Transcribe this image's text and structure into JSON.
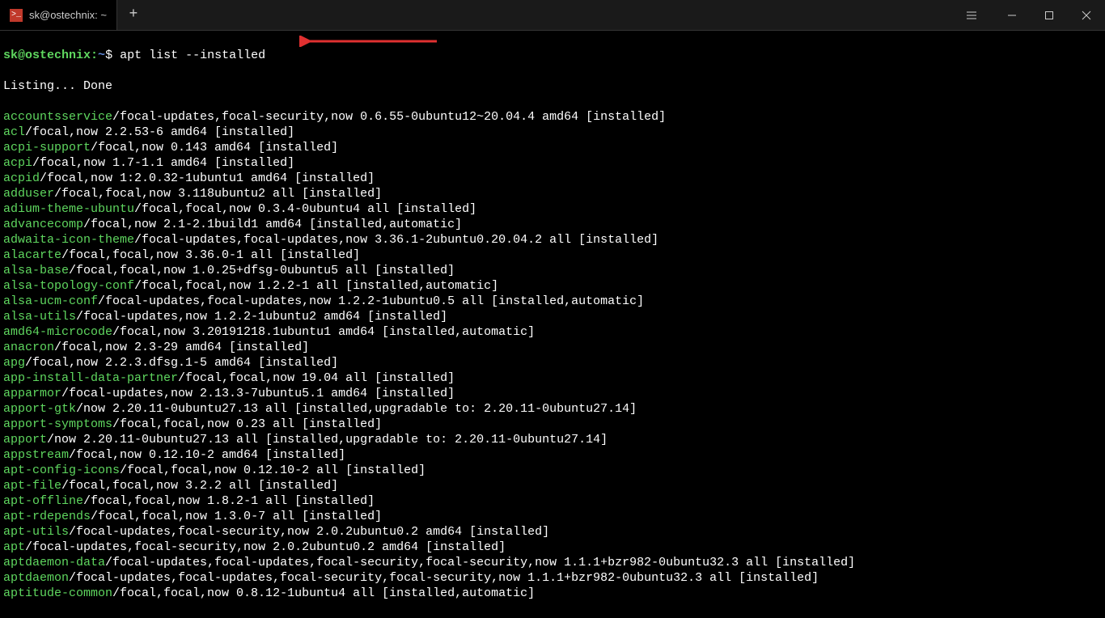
{
  "titlebar": {
    "tab_title": "sk@ostechnix: ~",
    "new_tab": "+"
  },
  "prompt": {
    "user_host": "sk@ostechnix",
    "sep": ":",
    "path": "~",
    "dollar": "$",
    "command": "apt list --installed"
  },
  "listing_line": "Listing... Done",
  "packages": [
    {
      "pkg": "accountsservice",
      "rest": "/focal-updates,focal-security,now 0.6.55-0ubuntu12~20.04.4 amd64 [installed]"
    },
    {
      "pkg": "acl",
      "rest": "/focal,now 2.2.53-6 amd64 [installed]"
    },
    {
      "pkg": "acpi-support",
      "rest": "/focal,now 0.143 amd64 [installed]"
    },
    {
      "pkg": "acpi",
      "rest": "/focal,now 1.7-1.1 amd64 [installed]"
    },
    {
      "pkg": "acpid",
      "rest": "/focal,now 1:2.0.32-1ubuntu1 amd64 [installed]"
    },
    {
      "pkg": "adduser",
      "rest": "/focal,focal,now 3.118ubuntu2 all [installed]"
    },
    {
      "pkg": "adium-theme-ubuntu",
      "rest": "/focal,focal,now 0.3.4-0ubuntu4 all [installed]"
    },
    {
      "pkg": "advancecomp",
      "rest": "/focal,now 2.1-2.1build1 amd64 [installed,automatic]"
    },
    {
      "pkg": "adwaita-icon-theme",
      "rest": "/focal-updates,focal-updates,now 3.36.1-2ubuntu0.20.04.2 all [installed]"
    },
    {
      "pkg": "alacarte",
      "rest": "/focal,focal,now 3.36.0-1 all [installed]"
    },
    {
      "pkg": "alsa-base",
      "rest": "/focal,focal,now 1.0.25+dfsg-0ubuntu5 all [installed]"
    },
    {
      "pkg": "alsa-topology-conf",
      "rest": "/focal,focal,now 1.2.2-1 all [installed,automatic]"
    },
    {
      "pkg": "alsa-ucm-conf",
      "rest": "/focal-updates,focal-updates,now 1.2.2-1ubuntu0.5 all [installed,automatic]"
    },
    {
      "pkg": "alsa-utils",
      "rest": "/focal-updates,now 1.2.2-1ubuntu2 amd64 [installed]"
    },
    {
      "pkg": "amd64-microcode",
      "rest": "/focal,now 3.20191218.1ubuntu1 amd64 [installed,automatic]"
    },
    {
      "pkg": "anacron",
      "rest": "/focal,now 2.3-29 amd64 [installed]"
    },
    {
      "pkg": "apg",
      "rest": "/focal,now 2.2.3.dfsg.1-5 amd64 [installed]"
    },
    {
      "pkg": "app-install-data-partner",
      "rest": "/focal,focal,now 19.04 all [installed]"
    },
    {
      "pkg": "apparmor",
      "rest": "/focal-updates,now 2.13.3-7ubuntu5.1 amd64 [installed]"
    },
    {
      "pkg": "apport-gtk",
      "rest": "/now 2.20.11-0ubuntu27.13 all [installed,upgradable to: 2.20.11-0ubuntu27.14]"
    },
    {
      "pkg": "apport-symptoms",
      "rest": "/focal,focal,now 0.23 all [installed]"
    },
    {
      "pkg": "apport",
      "rest": "/now 2.20.11-0ubuntu27.13 all [installed,upgradable to: 2.20.11-0ubuntu27.14]"
    },
    {
      "pkg": "appstream",
      "rest": "/focal,now 0.12.10-2 amd64 [installed]"
    },
    {
      "pkg": "apt-config-icons",
      "rest": "/focal,focal,now 0.12.10-2 all [installed]"
    },
    {
      "pkg": "apt-file",
      "rest": "/focal,focal,now 3.2.2 all [installed]"
    },
    {
      "pkg": "apt-offline",
      "rest": "/focal,focal,now 1.8.2-1 all [installed]"
    },
    {
      "pkg": "apt-rdepends",
      "rest": "/focal,focal,now 1.3.0-7 all [installed]"
    },
    {
      "pkg": "apt-utils",
      "rest": "/focal-updates,focal-security,now 2.0.2ubuntu0.2 amd64 [installed]"
    },
    {
      "pkg": "apt",
      "rest": "/focal-updates,focal-security,now 2.0.2ubuntu0.2 amd64 [installed]"
    },
    {
      "pkg": "aptdaemon-data",
      "rest": "/focal-updates,focal-updates,focal-security,focal-security,now 1.1.1+bzr982-0ubuntu32.3 all [installed]"
    },
    {
      "pkg": "aptdaemon",
      "rest": "/focal-updates,focal-updates,focal-security,focal-security,now 1.1.1+bzr982-0ubuntu32.3 all [installed]"
    },
    {
      "pkg": "aptitude-common",
      "rest": "/focal,focal,now 0.8.12-1ubuntu4 all [installed,automatic]"
    }
  ]
}
